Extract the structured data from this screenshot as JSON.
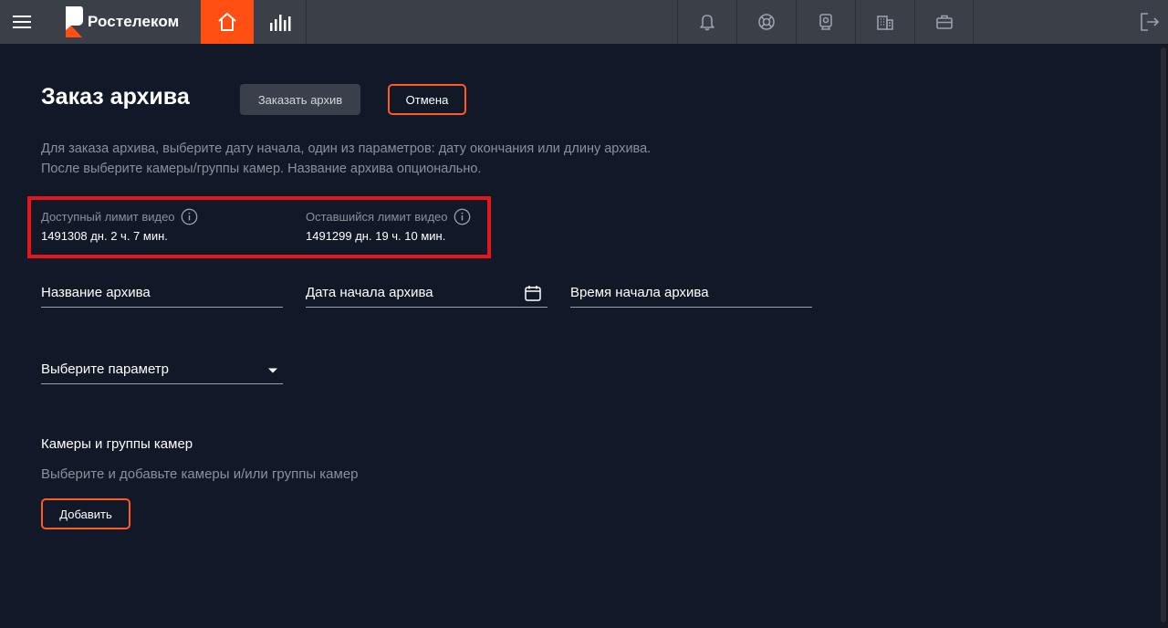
{
  "header": {
    "logo_text": "Ростелеком",
    "menu_icon": "hamburger-icon",
    "home_icon": "home-icon",
    "stats_icon": "bar-chart-icon",
    "right_icons": [
      "bell-icon",
      "lifebuoy-icon",
      "camera-icon",
      "building-icon",
      "briefcase-icon"
    ],
    "exit_icon": "exit-icon",
    "accent_color": "#ff4f12"
  },
  "page": {
    "title": "Заказ архива",
    "order_button": "Заказать архив",
    "cancel_button": "Отмена",
    "description_line1": "Для заказа архива, выберите дату начала, один из параметров: дату окончания или длину архива.",
    "description_line2": "После выберите камеры/группы камер. Название архива опционально."
  },
  "limits": {
    "available_label": "Доступный лимит видео",
    "available_value": "1491308 дн. 2 ч. 7 мин.",
    "remaining_label": "Оставшийся лимит видео",
    "remaining_value": "1491299 дн. 19 ч. 10 мин.",
    "highlight_color": "#e8141b"
  },
  "form": {
    "archive_name_label": "Название архива",
    "start_date_label": "Дата начала архива",
    "start_time_label": "Время начала архива",
    "parameter_label": "Выберите параметр"
  },
  "cameras": {
    "title": "Камеры и группы камер",
    "hint": "Выберите и добавьте камеры и/или группы камер",
    "add_button": "Добавить"
  }
}
